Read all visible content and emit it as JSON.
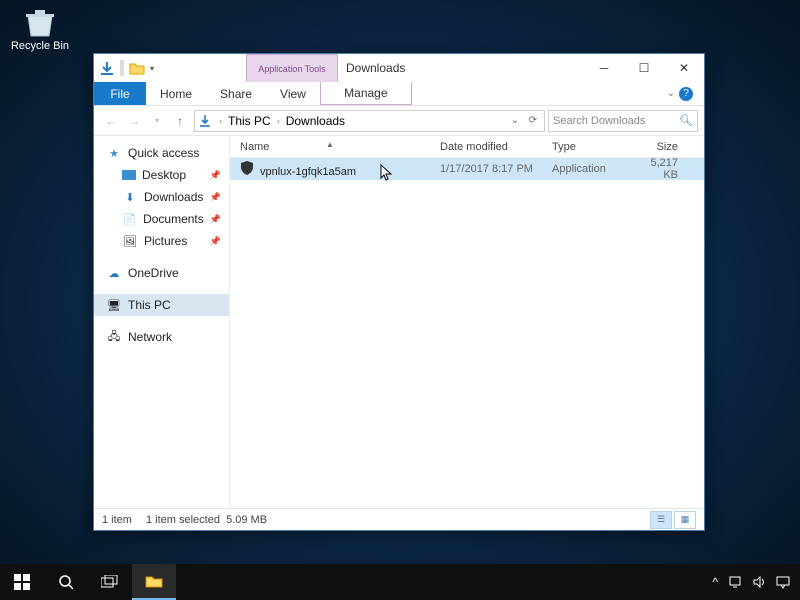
{
  "desktop": {
    "recycle_bin": "Recycle Bin"
  },
  "window": {
    "context_tab": "Application Tools",
    "title": "Downloads",
    "ribbon": {
      "file": "File",
      "tabs": [
        "Home",
        "Share",
        "View"
      ],
      "context": "Manage"
    },
    "breadcrumb": {
      "seg0": "This PC",
      "seg1": "Downloads"
    },
    "search": {
      "placeholder": "Search Downloads"
    },
    "nav": {
      "quick_access": "Quick access",
      "desktop": "Desktop",
      "downloads": "Downloads",
      "documents": "Documents",
      "pictures": "Pictures",
      "onedrive": "OneDrive",
      "this_pc": "This PC",
      "network": "Network"
    },
    "columns": {
      "name": "Name",
      "date": "Date modified",
      "type": "Type",
      "size": "Size"
    },
    "files": [
      {
        "name": "vpnlux-1gfqk1a5am",
        "date": "1/17/2017 8:17 PM",
        "type": "Application",
        "size": "5,217 KB"
      }
    ],
    "status": {
      "count": "1 item",
      "selection": "1 item selected",
      "selsize": "5.09 MB"
    }
  }
}
